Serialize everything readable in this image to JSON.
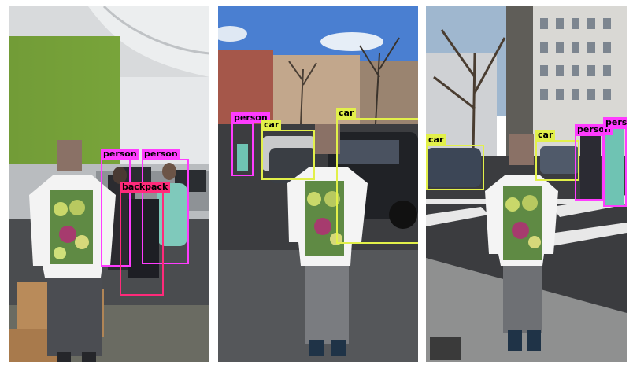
{
  "colors": {
    "person": "#ff3cff",
    "backpack": "#ff2a7a",
    "car": "#e2f04a"
  },
  "panels": [
    {
      "detections": [
        {
          "label": "person"
        },
        {
          "label": "person"
        },
        {
          "label": "backpack"
        }
      ]
    },
    {
      "detections": [
        {
          "label": "person"
        },
        {
          "label": "car"
        },
        {
          "label": "car"
        }
      ]
    },
    {
      "detections": [
        {
          "label": "car"
        },
        {
          "label": "car"
        },
        {
          "label": "person"
        },
        {
          "label": "person"
        }
      ]
    }
  ]
}
